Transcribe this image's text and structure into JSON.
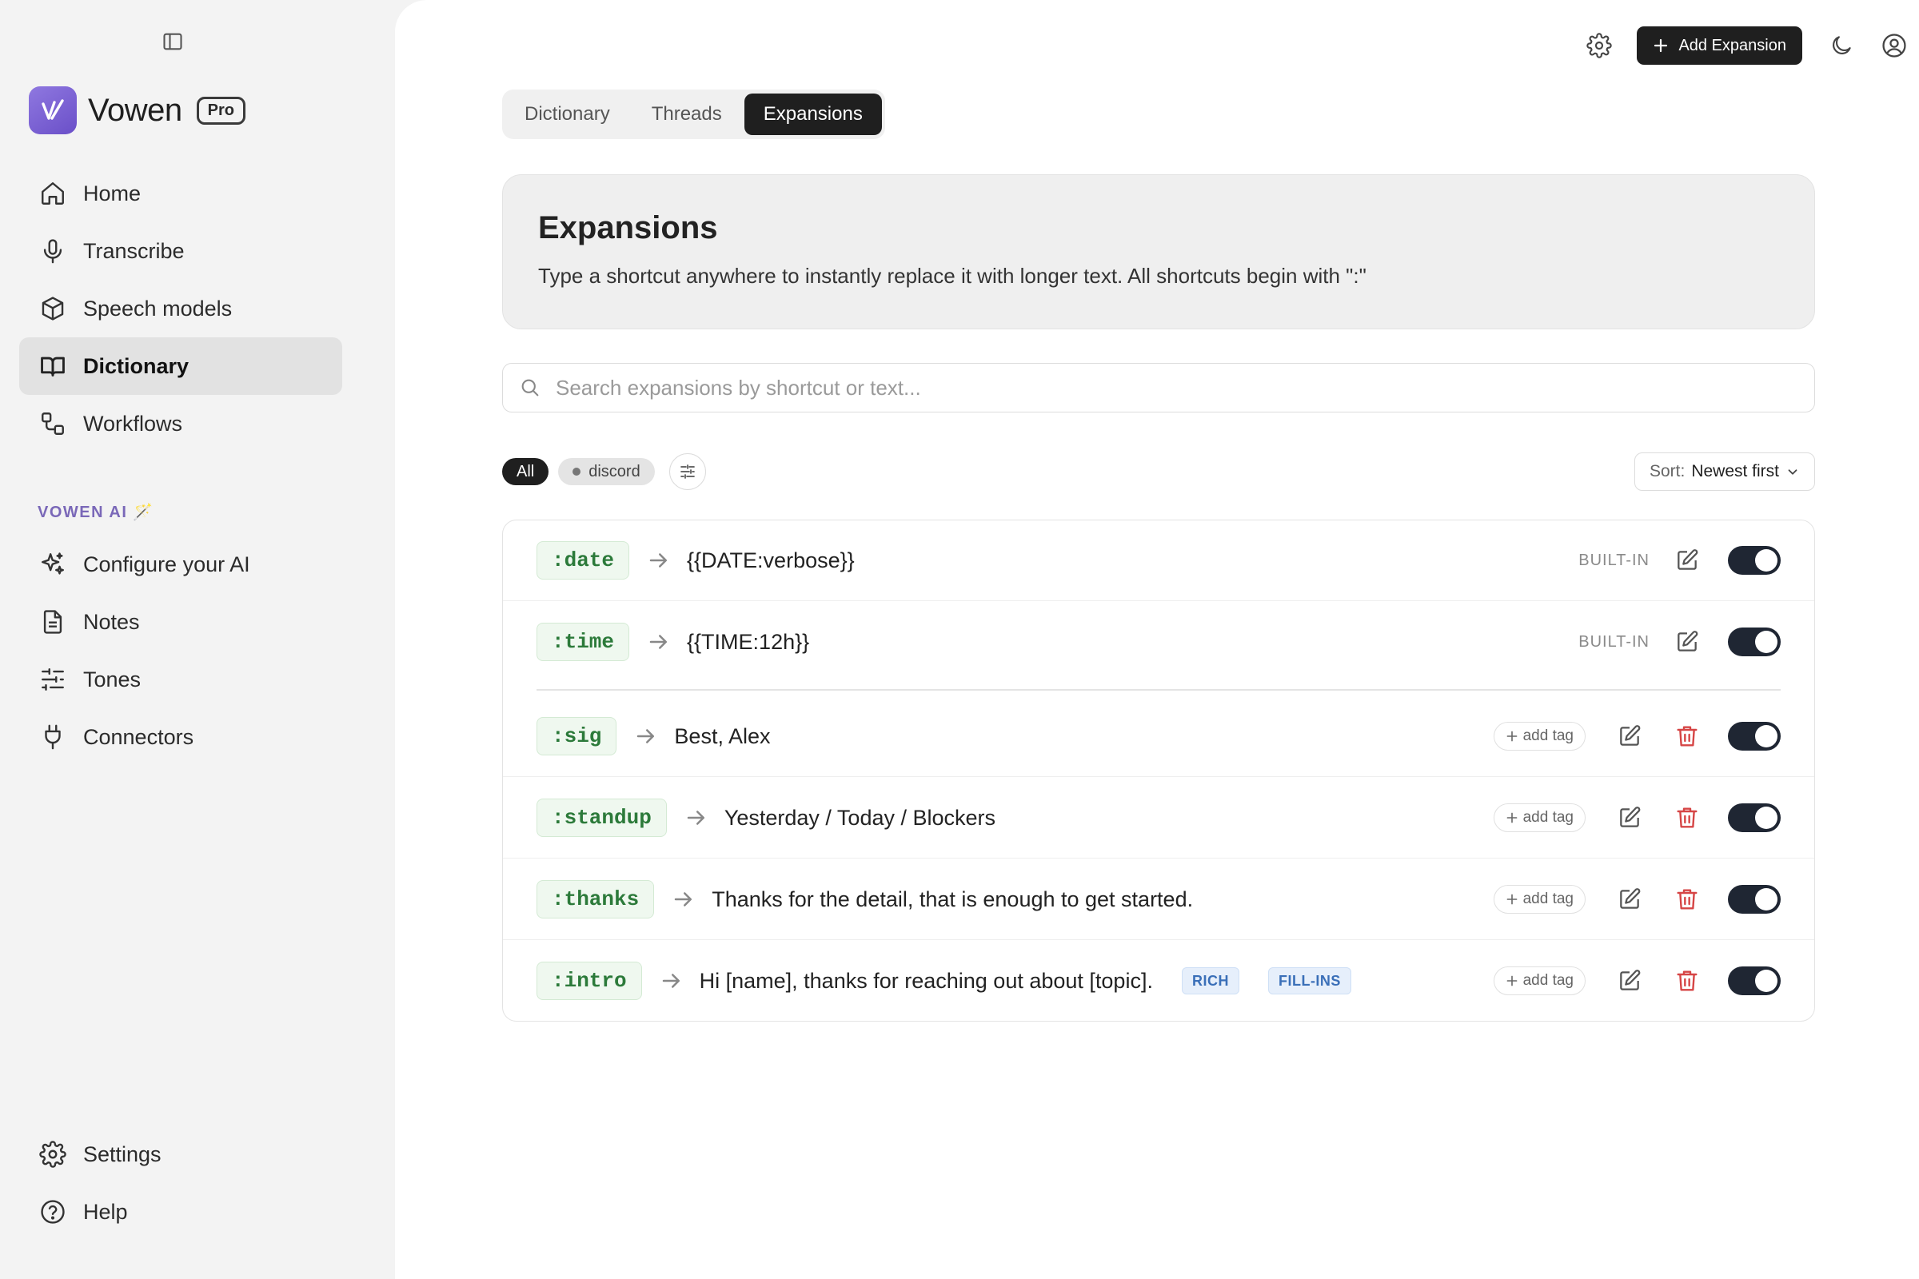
{
  "app": {
    "brand": "Vowen",
    "plan_badge": "Pro",
    "accent": "#6a4fc8"
  },
  "sidebar": {
    "items": [
      {
        "label": "Home",
        "icon": "home-icon"
      },
      {
        "label": "Transcribe",
        "icon": "microphone-icon"
      },
      {
        "label": "Speech models",
        "icon": "cube-icon"
      },
      {
        "label": "Dictionary",
        "icon": "book-icon",
        "active": true
      },
      {
        "label": "Workflows",
        "icon": "workflow-icon"
      }
    ],
    "section_label": "VOWEN AI 🪄",
    "ai_items": [
      {
        "label": "Configure your AI",
        "icon": "sparkles-icon"
      },
      {
        "label": "Notes",
        "icon": "document-icon"
      },
      {
        "label": "Tones",
        "icon": "sliders-icon"
      },
      {
        "label": "Connectors",
        "icon": "plug-icon"
      }
    ],
    "bottom_items": [
      {
        "label": "Settings",
        "icon": "gear-icon"
      },
      {
        "label": "Help",
        "icon": "help-circle-icon"
      }
    ]
  },
  "toolbar": {
    "add_label": "Add Expansion"
  },
  "tabs": [
    {
      "label": "Dictionary",
      "active": false
    },
    {
      "label": "Threads",
      "active": false
    },
    {
      "label": "Expansions",
      "active": true
    }
  ],
  "header": {
    "title": "Expansions",
    "description": "Type a shortcut anywhere to instantly replace it with longer text. All shortcuts begin with \":\""
  },
  "search": {
    "placeholder": "Search expansions by shortcut or text...",
    "value": ""
  },
  "filters": {
    "all_label": "All",
    "tag_label": "discord"
  },
  "sort": {
    "label": "Sort:",
    "value": "Newest first"
  },
  "expansions": {
    "builtin_label": "BUILT-IN",
    "add_tag_label": "add tag",
    "builtin": [
      {
        "shortcut": ":date",
        "text": "{{DATE:verbose}}",
        "enabled": true
      },
      {
        "shortcut": ":time",
        "text": "{{TIME:12h}}",
        "enabled": true
      }
    ],
    "custom": [
      {
        "shortcut": ":sig",
        "text": "Best, Alex",
        "enabled": true
      },
      {
        "shortcut": ":standup",
        "text": "Yesterday / Today / Blockers",
        "enabled": true
      },
      {
        "shortcut": ":thanks",
        "text": "Thanks for the detail, that is enough to get started.",
        "enabled": true
      },
      {
        "shortcut": ":intro",
        "text": "Hi [name], thanks for reaching out about [topic].",
        "enabled": true,
        "badges": [
          "RICH",
          "FILL-INS"
        ]
      }
    ]
  }
}
